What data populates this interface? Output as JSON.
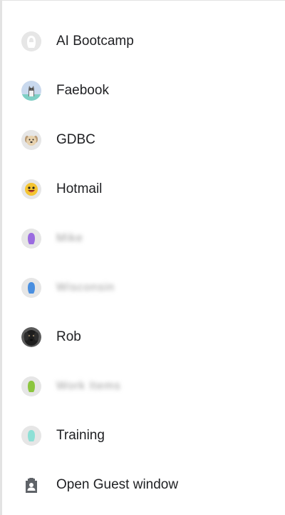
{
  "profiles": [
    {
      "label": "AI Bootcamp",
      "icon": "default-avatar-icon",
      "color": "#bdbdbd",
      "blurred": false
    },
    {
      "label": "Faebook",
      "icon": "cat-avatar-icon",
      "color": "#8fb6e6",
      "blurred": false
    },
    {
      "label": "GDBC",
      "icon": "dog-avatar-icon",
      "color": "#d8c3a2",
      "blurred": false
    },
    {
      "label": "Hotmail",
      "icon": "emoji-avatar-icon",
      "color": "#f2c230",
      "blurred": false
    },
    {
      "label": "Mike",
      "icon": "purple-avatar-icon",
      "color": "#9b6ce0",
      "blurred": true
    },
    {
      "label": "Wisconsin",
      "icon": "blue-avatar-icon",
      "color": "#4a8fe0",
      "blurred": true
    },
    {
      "label": "Rob",
      "icon": "dog-photo-avatar-icon",
      "color": "#2b2b2b",
      "blurred": false
    },
    {
      "label": "Work Items",
      "icon": "green-avatar-icon",
      "color": "#8cc63f",
      "blurred": true
    },
    {
      "label": "Training",
      "icon": "teal-avatar-icon",
      "color": "#8ee0d6",
      "blurred": false
    }
  ],
  "guest": {
    "label": "Open Guest window",
    "icon": "guest-badge-icon",
    "color": "#5f6368"
  }
}
